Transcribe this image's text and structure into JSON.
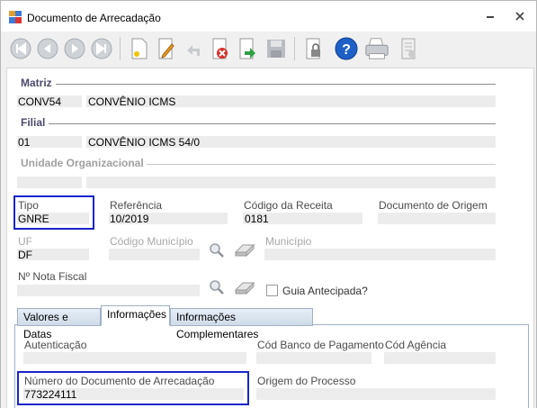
{
  "window": {
    "title": "Documento de Arrecadação"
  },
  "toolbar": {
    "buttons": [
      "first-icon",
      "previous-icon",
      "next-icon",
      "last-icon",
      "new-icon",
      "edit-icon",
      "undo-icon",
      "delete-icon",
      "confirm-icon",
      "save-icon",
      "lock-icon",
      "help-icon",
      "print-icon",
      "report-icon"
    ]
  },
  "matriz": {
    "heading": "Matriz",
    "code": "CONV54",
    "name": "CONVÊNIO ICMS"
  },
  "filial": {
    "heading": "Filial",
    "code": "01",
    "name": "CONVÊNIO ICMS 54/0"
  },
  "unidade": {
    "heading": "Unidade Organizacional",
    "code": "",
    "name": ""
  },
  "tipo": {
    "label": "Tipo",
    "value": "GNRE"
  },
  "referencia": {
    "label": "Referência",
    "value": "10/2019"
  },
  "codigo_receita": {
    "label": "Código da Receita",
    "value": "0181"
  },
  "documento_origem": {
    "label": "Documento de Origem",
    "value": ""
  },
  "uf": {
    "label": "UF",
    "value": "DF"
  },
  "codigo_municipio": {
    "label": "Código Município",
    "value": ""
  },
  "municipio": {
    "label": "Município",
    "value": ""
  },
  "nota_fiscal": {
    "label": "Nº Nota Fiscal",
    "value": ""
  },
  "guia_antecipada": {
    "label": "Guia Antecipada?",
    "checked": false
  },
  "tabs": [
    {
      "label": "Valores e Datas"
    },
    {
      "label": "Informações"
    },
    {
      "label": "Informações Complementares"
    }
  ],
  "info": {
    "autenticacao": {
      "label": "Autenticação",
      "value": ""
    },
    "cod_banco": {
      "label": "Cód Banco de Pagamento",
      "value": ""
    },
    "cod_agencia": {
      "label": "Cód Agência",
      "value": ""
    },
    "numero_documento": {
      "label": "Número do Documento de Arrecadação",
      "value": "773224111"
    },
    "origem_processo": {
      "label": "Origem do Processo",
      "value": ""
    }
  },
  "colors": {
    "highlight": "#1a24c8",
    "section_text": "#4a4a6a"
  }
}
